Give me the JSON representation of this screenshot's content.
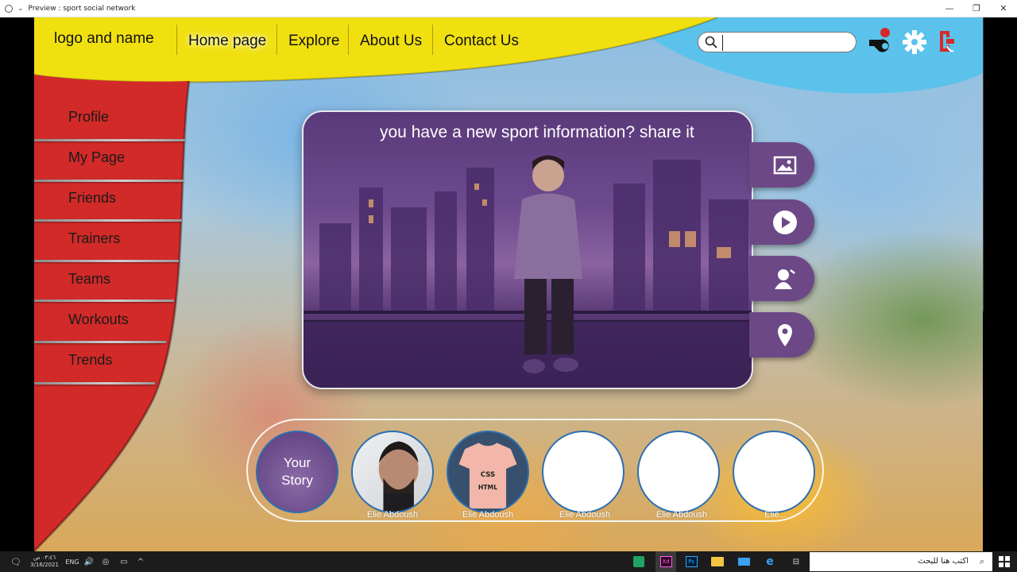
{
  "window": {
    "title": "Preview : sport social network",
    "controls": [
      "—",
      "❐",
      "✕"
    ]
  },
  "nav": {
    "logo": "logo and name",
    "items": [
      "Home page",
      "Explore",
      "About Us",
      "Contact Us"
    ],
    "active": "Home page",
    "search_placeholder": ""
  },
  "top_icons": [
    "whistle-notification-icon",
    "gear-icon",
    "logout-icon"
  ],
  "sidebar": {
    "items": [
      "Profile",
      "My Page",
      "Friends",
      "Trainers",
      "Teams",
      "Workouts",
      "Trends"
    ]
  },
  "post": {
    "prompt": "you have a new sport information? share it"
  },
  "actions": [
    "image-icon",
    "video-play-icon",
    "tag-person-icon",
    "location-pin-icon"
  ],
  "stories": {
    "your_story": "Your Story",
    "items": [
      {
        "name": "Elie Abdoush"
      },
      {
        "name": "Elie Abdoush"
      },
      {
        "name": "Elie Abdoush"
      },
      {
        "name": "Elie Abdoush"
      },
      {
        "name": "Elie..."
      }
    ]
  },
  "taskbar": {
    "time": "٠٣:٤٦ ص",
    "date": "3/16/2021",
    "lang": "ENG",
    "search_text": "اكتب هنا للبحث",
    "apps": [
      "Xd",
      "Ps"
    ]
  },
  "colors": {
    "yellow": "#f0e010",
    "red": "#d22a28",
    "blue": "#5bc2ec",
    "purple": "#6c4886"
  }
}
